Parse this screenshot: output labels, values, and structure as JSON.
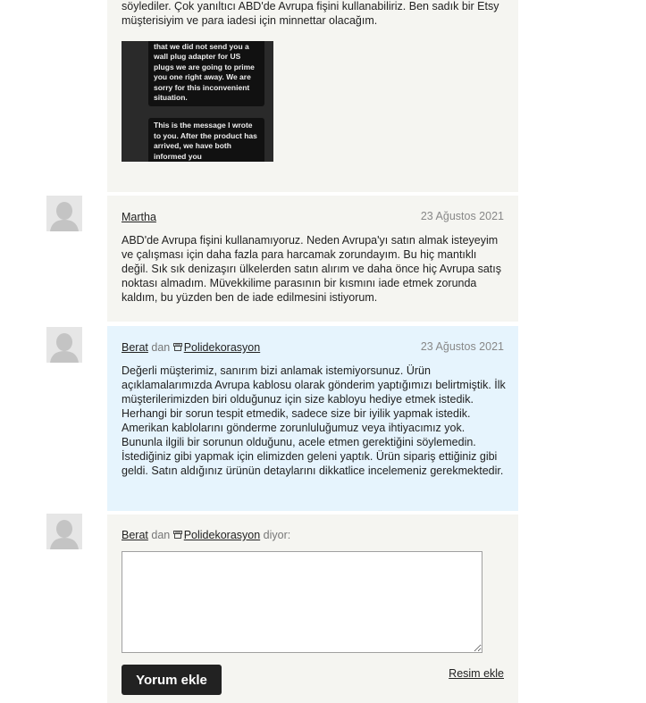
{
  "first_comment": {
    "text_tail": "söylediler. Çok yanıltıcı ABD'de Avrupa fişini kullanabiliriz. Ben sadık bir Etsy müşterisiyim ve para iadesi için minnettar olacağım.",
    "screenshot_text_1": "the orders and found out that we did not send you a wall plug adapter for US plugs we are going to prime you one right away. We are sorry for this inconvenient situation.",
    "screenshot_text_2": "This is the message I wrote to you. After the product has arrived, we have both informed you"
  },
  "comment_martha": {
    "author": "Martha",
    "date": "23 Ağustos 2021",
    "text": "ABD'de Avrupa fişini kullanamıyoruz. Neden Avrupa'yı satın almak isteyeyim ve çalışması için daha fazla para harcamak zorundayım. Bu hiç mantıklı değil. Sık sık denizaşırı ülkelerden satın alırım ve daha önce hiç Avrupa satış noktası almadım. Müvekkilime parasının bir kısmını iade etmek zorunda kaldım, bu yüzden ben de iade edilmesini istiyorum."
  },
  "comment_seller": {
    "author": "Berat",
    "from": "dan",
    "shop": "Polidekorasyon",
    "date": "23 Ağustos 2021",
    "text": "Değerli müşterimiz, sanırım bizi anlamak istemiyorsunuz. Ürün açıklamalarımızda Avrupa kablosu olarak gönderim yaptığımızı belirtmiştik. İlk müşterilerimizden biri olduğunuz için size kabloyu hediye etmek istedik. Herhangi bir sorun tespit etmedik, sadece size bir iyilik yapmak istedik. Amerikan kablolarını gönderme zorunluluğumuz veya ihtiyacımız yok. Bununla ilgili bir sorunun olduğunu, acele etmen gerektiğini söylemedin. İstediğiniz gibi yapmak için elimizden geleni yaptık. Ürün sipariş ettiğiniz gibi geldi. Satın aldığınız ürünün detaylarını dikkatlice incelemeniz gerekmektedir."
  },
  "reply_form": {
    "author": "Berat",
    "from": "dan",
    "shop": "Polidekorasyon",
    "says": "diyor:",
    "textarea_value": "",
    "submit_label": "Yorum ekle",
    "add_image_label": "Resim ekle"
  },
  "colors": {
    "beige_panel": "#f5f5f1",
    "seller_panel": "#e6f4fd",
    "button": "#222222"
  }
}
